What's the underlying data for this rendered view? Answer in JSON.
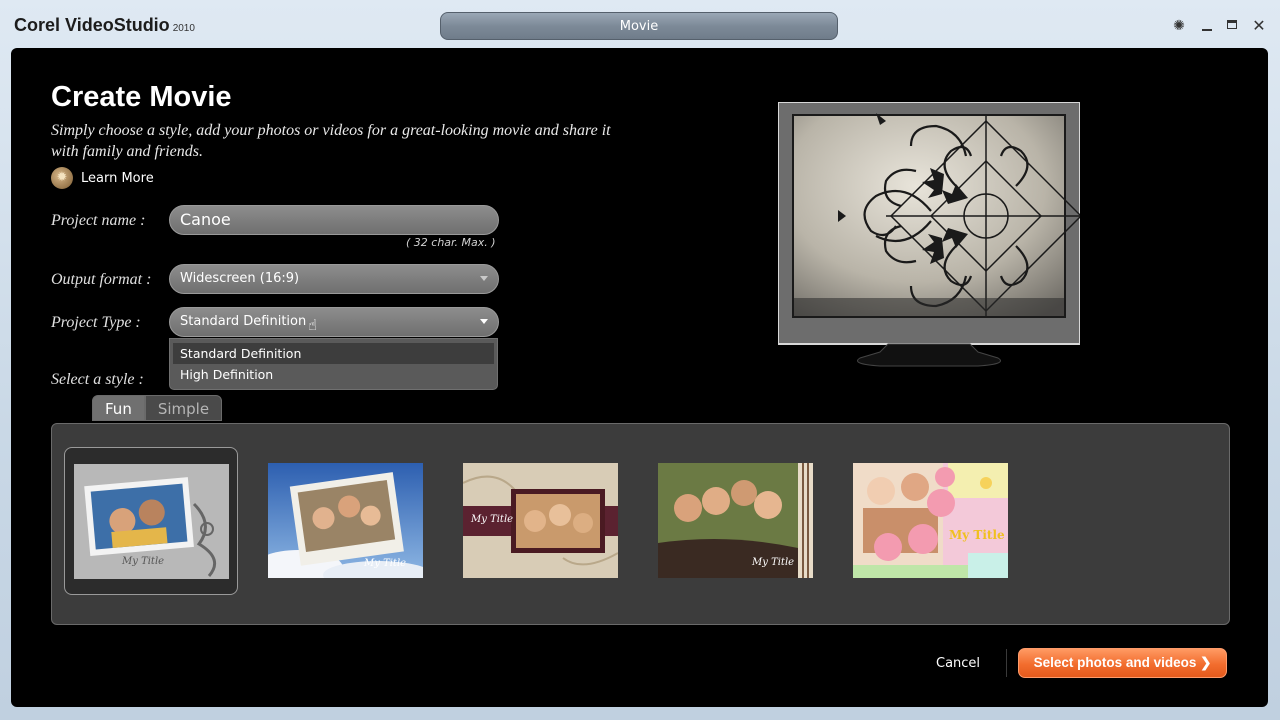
{
  "window": {
    "app_name": "Corel VideoStudio",
    "version": "2010",
    "center_tab": "Movie"
  },
  "page": {
    "heading": "Create Movie",
    "subtitle": "Simply choose a style, add your photos or videos for a great-looking movie and share it with family and friends.",
    "learn_more": "Learn More"
  },
  "form": {
    "project_name_label": "Project name :",
    "project_name_value": "Canoe",
    "char_limit_note": "( 32 char. Max. )",
    "output_format_label": "Output format :",
    "output_format_value": "Widescreen (16:9)",
    "project_type_label": "Project Type :",
    "project_type_value": "Standard Definition",
    "project_type_options": [
      "Standard Definition",
      "High Definition"
    ],
    "select_style_label": "Select a style :"
  },
  "style_tabs": [
    "Fun",
    "Simple"
  ],
  "style_thumbnails": [
    {
      "caption": "My Title",
      "selected": true
    },
    {
      "caption": "My Title",
      "selected": false
    },
    {
      "caption": "My Title",
      "selected": false
    },
    {
      "caption": "My Title",
      "selected": false
    },
    {
      "caption": "My Title",
      "selected": false
    }
  ],
  "actions": {
    "cancel": "Cancel",
    "next": "Select photos and videos ❯"
  },
  "colors": {
    "accent": "#f26d2e",
    "panel": "#000000"
  }
}
